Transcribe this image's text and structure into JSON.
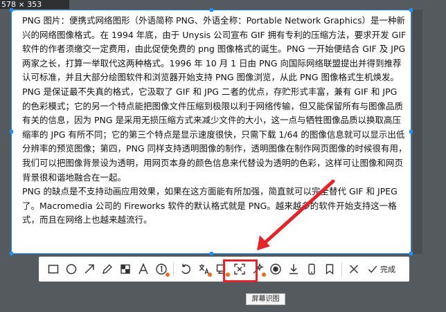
{
  "selection": {
    "dimensions": "578 × 353"
  },
  "document": {
    "paragraphs": [
      "PNG 图片：便携式网络图形（外语简称 PNG、外语全称：Portable Network Graphics）是一种新兴的网络图像格式。在 1994 年底，由于 Unysis 公司宣布 GIF 拥有专利的压缩方法，要求开发 GIF 软件的作者须缴交一定费用，由此促使免费的 png 图像格式的诞生。PNG 一开始便结合 GIF 及 JPG 两家之长，打算一举取代这两种格式。1996 年 10 月 1 日由 PNG 向国际网络联盟提出并得到推荐认可标准，并且大部分绘图软件和浏览器开始支持 PNG 图像浏览，从此 PNG 图像格式生机焕发。",
      "PNG 是保证最不失真的格式，它汲取了 GIF 和 JPG 二者的优点，存贮形式丰富，兼有 GIF 和 JPG 的色彩模式；它的另一个特点能把图像文件压缩到极限以利于网络传输，但又能保留所有与图像品质有关的信息，因为 PNG 是采用无损压缩方式来减少文件的大小，这一点与牺牲图像品质以换取高压缩率的 JPG 有所不同；它的第三个特点是显示速度很快，只需下载 1/64 的图像信息就可以显示出低分辨率的预览图像；第四，PNG 同样支持透明图像的制作，透明图像在制作网页图像的时候很有用，我们可以把图像背景设为透明，用网页本身的颜色信息来代替设为透明的色彩，这样可让图像和网页背景很和谐地融合在一起。",
      "PNG 的缺点是不支持动画应用效果，如果在这方面能有所加强，简直就可以完全替代 GIF 和 JPEG 了。Macromedia 公司的 Fireworks 软件的默认格式就是 PNG。越来越多的软件开始支持这一格式，而且在网络上也越来越流行。"
    ]
  },
  "toolbar": {
    "tools": [
      {
        "icon": "rectangle-icon"
      },
      {
        "icon": "ellipse-icon"
      },
      {
        "icon": "arrow-icon"
      },
      {
        "icon": "pen-icon"
      },
      {
        "icon": "mosaic-icon"
      },
      {
        "icon": "text-icon"
      },
      {
        "icon": "number-marker-icon"
      },
      {
        "icon": "undo-icon"
      },
      {
        "icon": "screen-translate-icon"
      },
      {
        "icon": "pin-icon"
      },
      {
        "icon": "screen-ocr-icon"
      },
      {
        "icon": "magic-icon"
      },
      {
        "icon": "record-icon"
      },
      {
        "icon": "download-icon"
      },
      {
        "icon": "phone-icon"
      },
      {
        "icon": "bookmark-icon"
      },
      {
        "icon": "close-icon"
      }
    ],
    "done_label": "完成",
    "tooltip": "屏幕识图"
  },
  "colors": {
    "selection_border": "#1e90ff",
    "highlight": "#e3242b",
    "dot": "#e86c1d"
  }
}
